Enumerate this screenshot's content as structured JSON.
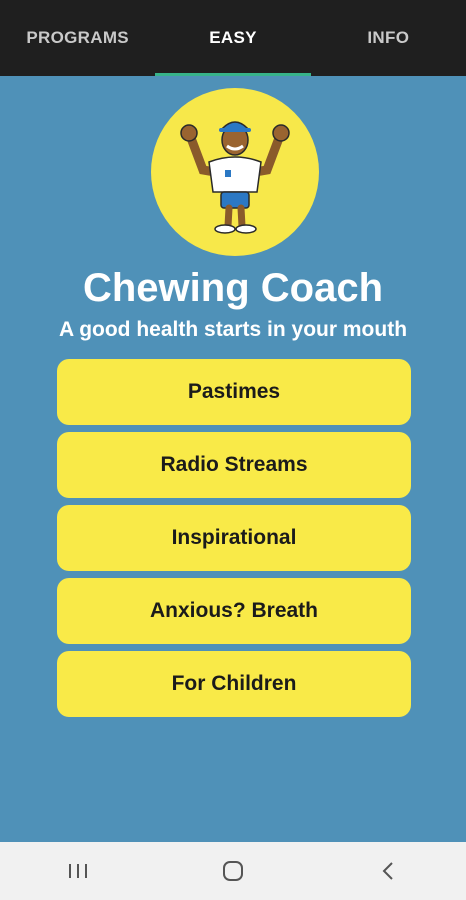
{
  "tabs": [
    {
      "label": "PROGRAMS",
      "active": false
    },
    {
      "label": "EASY",
      "active": true
    },
    {
      "label": "INFO",
      "active": false
    }
  ],
  "colors": {
    "background": "#4f91b8",
    "tabbar": "#1f1f1f",
    "tab_indicator": "#37b38a",
    "button": "#f9ea48",
    "logo_circle": "#f7e84a"
  },
  "logo": {
    "icon": "coach-mascot-icon"
  },
  "header": {
    "title": "Chewing Coach",
    "tagline": "A good health starts in your mouth"
  },
  "menu": {
    "items": [
      {
        "label": "Pastimes"
      },
      {
        "label": "Radio Streams"
      },
      {
        "label": "Inspirational"
      },
      {
        "label": "Anxious? Breath"
      },
      {
        "label": "For Children"
      }
    ]
  },
  "navbar": {
    "items": [
      {
        "icon": "recent-apps-icon"
      },
      {
        "icon": "home-icon"
      },
      {
        "icon": "back-icon"
      }
    ]
  }
}
